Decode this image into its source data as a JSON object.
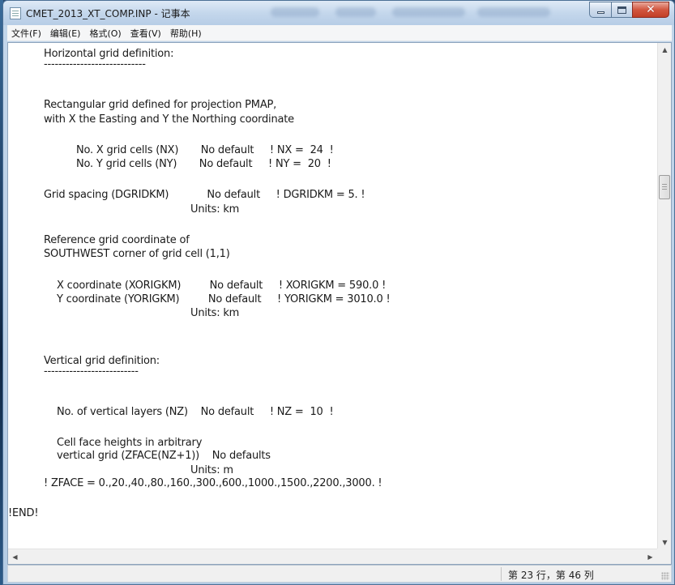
{
  "window": {
    "title": "CMET_2013_XT_COMP.INP - 记事本"
  },
  "menu": [
    {
      "label": "文件(F)"
    },
    {
      "label": "编辑(E)"
    },
    {
      "label": "格式(O)"
    },
    {
      "label": "查看(V)"
    },
    {
      "label": "帮助(H)"
    }
  ],
  "document": {
    "lines": [
      "Horizontal grid definition:",
      "----------------------------",
      "Rectangular grid defined for projection PMAP,",
      "with X the Easting and Y the Northing coordinate",
      "No. X grid cells (NX)       No default     ! NX =  24  !",
      "No. Y grid cells (NY)       No default     ! NY =  20  !",
      "Grid spacing (DGRIDKM)            No default     ! DGRIDKM = 5. !",
      "Units: km",
      "Reference grid coordinate of",
      "SOUTHWEST corner of grid cell (1,1)",
      "X coordinate (XORIGKM)         No default     ! XORIGKM = 590.0 !",
      "Y coordinate (YORIGKM)         No default     ! YORIGKM = 3010.0 !",
      "Units: km",
      "Vertical grid definition:",
      "--------------------------",
      "No. of vertical layers (NZ)    No default     ! NZ =  10  !",
      "Cell face heights in arbitrary",
      "vertical grid (ZFACE(NZ+1))    No defaults",
      "Units: m",
      "! ZFACE = 0.,20.,40.,80.,160.,300.,600.,1000.,1500.,2200.,3000. !",
      "!END!"
    ]
  },
  "status": {
    "position": "第 23 行，第 46 列"
  },
  "icons": {
    "app": "notepad-icon",
    "minimize": "minimize-icon",
    "maximize": "maximize-icon",
    "close": "close-icon"
  },
  "colors": {
    "close_button": "#c94a32",
    "titlebar": "#c4d7ec",
    "text": "#1a1a1a"
  }
}
